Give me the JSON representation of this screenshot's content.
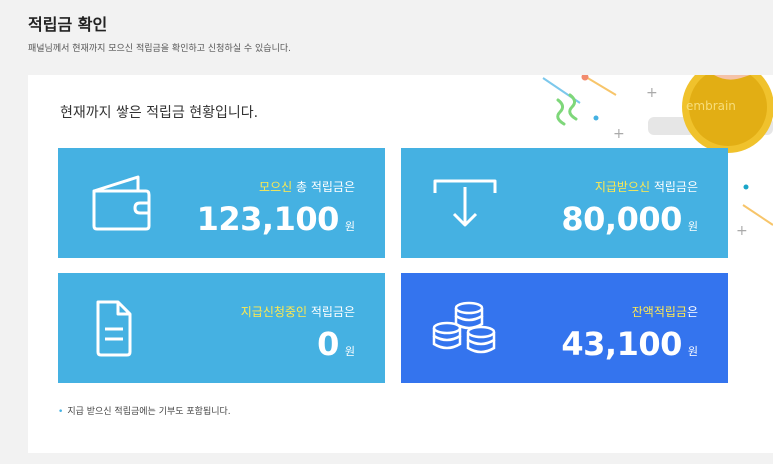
{
  "header": {
    "title": "적립금 확인",
    "description": "패널님께서 현재까지 모으신 적립금을 확인하고 신청하실 수 있습니다."
  },
  "summary": {
    "headline": "현재까지 쌓은 적립금 현황입니다.",
    "coin_text": "embrain",
    "currency": "원",
    "cards": [
      {
        "highlight": "모으신",
        "caption_rest": " 총 적립금은",
        "amount": "123,100",
        "icon": "wallet-icon"
      },
      {
        "highlight": "지급받으신",
        "caption_rest": " 적립금은",
        "amount": "80,000",
        "icon": "download-arrow-icon"
      },
      {
        "highlight": "지급신청중인",
        "caption_rest": " 적립금은",
        "amount": "0",
        "icon": "document-icon"
      },
      {
        "highlight": "잔액적립금",
        "caption_rest": "은",
        "amount": "43,100",
        "icon": "coins-icon"
      }
    ],
    "note": "지급 받으신 적립금에는 기부도 포함됩니다."
  },
  "colors": {
    "card_light": "#45b1e2",
    "card_dark": "#3474ee",
    "highlight": "#ffe94f"
  }
}
